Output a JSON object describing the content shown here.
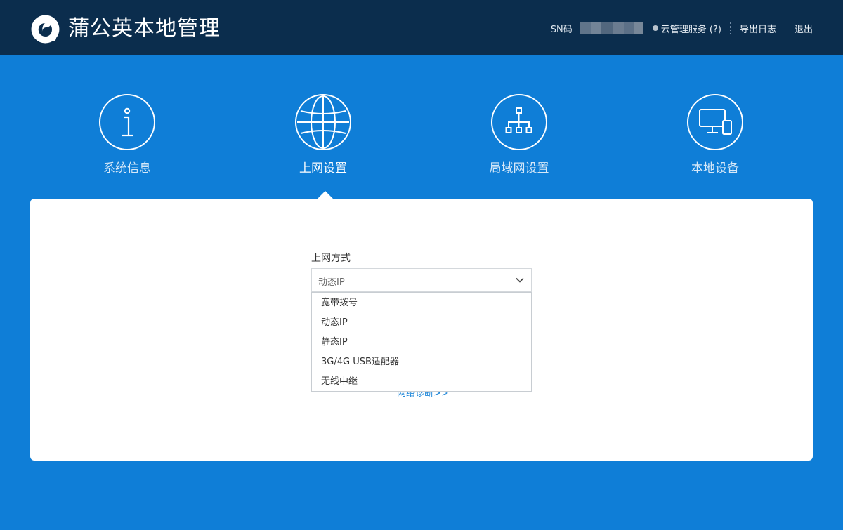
{
  "header": {
    "title": "蒲公英本地管理",
    "sn_label": "SN码",
    "cloud_service": "云管理服务 (?)",
    "export_log": "导出日志",
    "logout": "退出"
  },
  "nav": {
    "items": [
      {
        "label": "系统信息",
        "icon": "info-icon"
      },
      {
        "label": "上网设置",
        "icon": "globe-icon"
      },
      {
        "label": "局域网设置",
        "icon": "network-tree-icon"
      },
      {
        "label": "本地设备",
        "icon": "devices-icon"
      }
    ],
    "active_index": 1
  },
  "form": {
    "label": "上网方式",
    "selected": "动态IP",
    "options": [
      "宽带拨号",
      "动态IP",
      "静态IP",
      "3G/4G USB适配器",
      "无线中继"
    ],
    "diagnose_link": "网络诊断>>"
  },
  "colors": {
    "header_bg": "#0b2d4d",
    "page_bg": "#0f7ed7",
    "panel_bg": "#ffffff",
    "link": "#1e86d8"
  }
}
